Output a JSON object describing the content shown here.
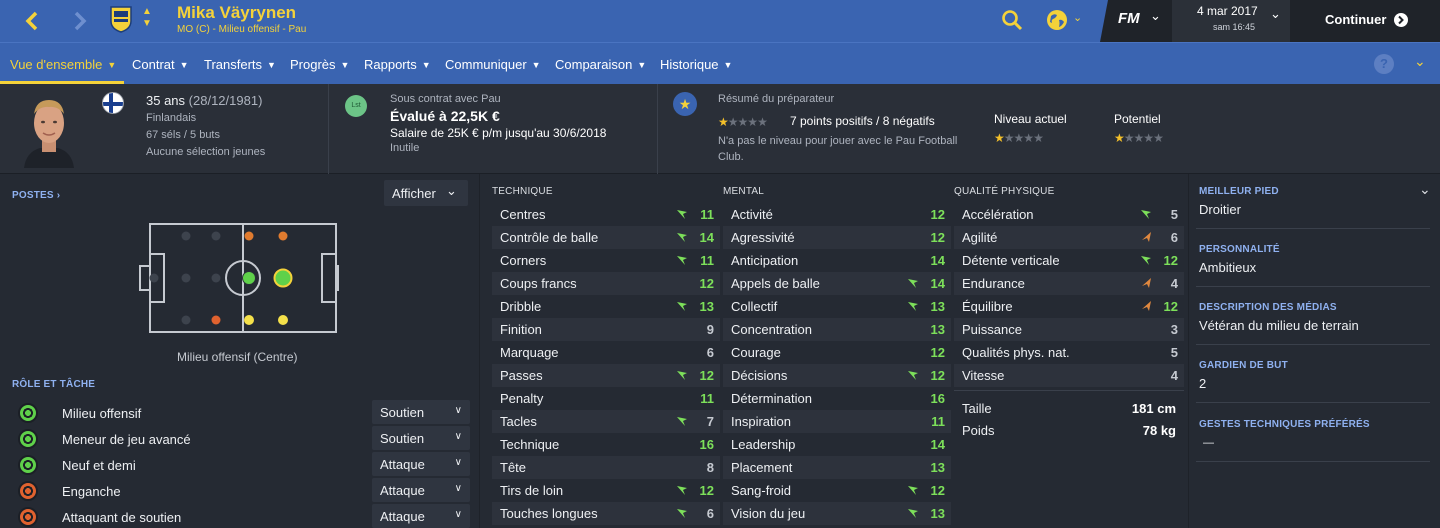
{
  "header": {
    "player_name": "Mika Väyrynen",
    "player_sub": "MO (C) - Milieu offensif - Pau",
    "game_logo": "FM",
    "date": "4 mar 2017",
    "time": "sam 16:45",
    "continue_label": "Continuer"
  },
  "tabs": [
    {
      "label": "Vue d'ensemble"
    },
    {
      "label": "Contrat"
    },
    {
      "label": "Transferts"
    },
    {
      "label": "Progrès"
    },
    {
      "label": "Rapports"
    },
    {
      "label": "Communiquer"
    },
    {
      "label": "Comparaison"
    },
    {
      "label": "Historique"
    }
  ],
  "info": {
    "age": "35 ans",
    "birth": "(28/12/1981)",
    "nationality": "Finlandais",
    "caps": "67 séls / 5 buts",
    "youth": "Aucune sélection jeunes",
    "badge": "Lst",
    "contract_label": "Sous contrat avec Pau",
    "value": "Évalué à 22,5K €",
    "salary": "Salaire de 25K € p/m jusqu'au 30/6/2018",
    "status": "Inutile",
    "scout_label": "Résumé du préparateur",
    "scout_points": "7 points positifs / 8 négatifs",
    "scout_note_1": "N'a pas le niveau pour jouer avec le Pau Football",
    "scout_note_2": "Club.",
    "current_label": "Niveau actuel",
    "potential_label": "Potentiel",
    "scout_stars": 1,
    "current_stars": 1,
    "potential_stars": 1
  },
  "positions": {
    "header": "POSTES",
    "button": "Afficher",
    "caption": "Milieu offensif (Centre)"
  },
  "roles": {
    "header": "RÔLE ET TÂCHE",
    "items": [
      {
        "name": "Milieu offensif",
        "duty": "Soutien",
        "color": "#5fd14a"
      },
      {
        "name": "Meneur de jeu avancé",
        "duty": "Soutien",
        "color": "#5fd14a"
      },
      {
        "name": "Neuf et demi",
        "duty": "Attaque",
        "color": "#5fd14a"
      },
      {
        "name": "Enganche",
        "duty": "Attaque",
        "color": "#e0622f"
      },
      {
        "name": "Attaquant de soutien",
        "duty": "Attaque",
        "color": "#e0622f"
      }
    ]
  },
  "technique": {
    "header": "TECHNIQUE",
    "rows": [
      {
        "name": "Centres",
        "value": "11",
        "arrow": "up"
      },
      {
        "name": "Contrôle de balle",
        "value": "14",
        "arrow": "up"
      },
      {
        "name": "Corners",
        "value": "11",
        "arrow": "up"
      },
      {
        "name": "Coups francs",
        "value": "12",
        "arrow": ""
      },
      {
        "name": "Dribble",
        "value": "13",
        "arrow": "up"
      },
      {
        "name": "Finition",
        "value": "9",
        "arrow": ""
      },
      {
        "name": "Marquage",
        "value": "6",
        "arrow": ""
      },
      {
        "name": "Passes",
        "value": "12",
        "arrow": "up"
      },
      {
        "name": "Penalty",
        "value": "11",
        "arrow": ""
      },
      {
        "name": "Tacles",
        "value": "7",
        "arrow": "up"
      },
      {
        "name": "Technique",
        "value": "16",
        "arrow": ""
      },
      {
        "name": "Tête",
        "value": "8",
        "arrow": ""
      },
      {
        "name": "Tirs de loin",
        "value": "12",
        "arrow": "up"
      },
      {
        "name": "Touches longues",
        "value": "6",
        "arrow": "up"
      }
    ]
  },
  "mental": {
    "header": "MENTAL",
    "rows": [
      {
        "name": "Activité",
        "value": "12",
        "arrow": ""
      },
      {
        "name": "Agressivité",
        "value": "12",
        "arrow": ""
      },
      {
        "name": "Anticipation",
        "value": "14",
        "arrow": ""
      },
      {
        "name": "Appels de balle",
        "value": "14",
        "arrow": "up"
      },
      {
        "name": "Collectif",
        "value": "13",
        "arrow": "up"
      },
      {
        "name": "Concentration",
        "value": "13",
        "arrow": ""
      },
      {
        "name": "Courage",
        "value": "12",
        "arrow": ""
      },
      {
        "name": "Décisions",
        "value": "12",
        "arrow": "up"
      },
      {
        "name": "Détermination",
        "value": "16",
        "arrow": ""
      },
      {
        "name": "Inspiration",
        "value": "11",
        "arrow": ""
      },
      {
        "name": "Leadership",
        "value": "14",
        "arrow": ""
      },
      {
        "name": "Placement",
        "value": "13",
        "arrow": ""
      },
      {
        "name": "Sang-froid",
        "value": "12",
        "arrow": "up"
      },
      {
        "name": "Vision du jeu",
        "value": "13",
        "arrow": "up"
      }
    ]
  },
  "physical": {
    "header": "QUALITÉ PHYSIQUE",
    "rows": [
      {
        "name": "Accélération",
        "value": "5",
        "arrow": "up"
      },
      {
        "name": "Agilité",
        "value": "6",
        "arrow": "down"
      },
      {
        "name": "Détente verticale",
        "value": "12",
        "arrow": "up"
      },
      {
        "name": "Endurance",
        "value": "4",
        "arrow": "down"
      },
      {
        "name": "Équilibre",
        "value": "12",
        "arrow": "down"
      },
      {
        "name": "Puissance",
        "value": "3",
        "arrow": ""
      },
      {
        "name": "Qualités phys. nat.",
        "value": "5",
        "arrow": ""
      },
      {
        "name": "Vitesse",
        "value": "4",
        "arrow": ""
      }
    ],
    "height_label": "Taille",
    "height": "181 cm",
    "weight_label": "Poids",
    "weight": "78 kg"
  },
  "side": {
    "foot_label": "MEILLEUR PIED",
    "foot": "Droitier",
    "personality_label": "PERSONNALITÉ",
    "personality": "Ambitieux",
    "media_label": "DESCRIPTION DES MÉDIAS",
    "media": "Vétéran du milieu de terrain",
    "gk_label": "GARDIEN DE BUT",
    "gk": "2",
    "traits_label": "GESTES TECHNIQUES PRÉFÉRÉS",
    "traits": "—"
  },
  "colors": {
    "header_blue": "#3a64b1",
    "accent_yellow": "#f4d23a",
    "attr_green": "#7de05a",
    "arrow_up": "#7de05a",
    "arrow_down": "#e0883f"
  }
}
